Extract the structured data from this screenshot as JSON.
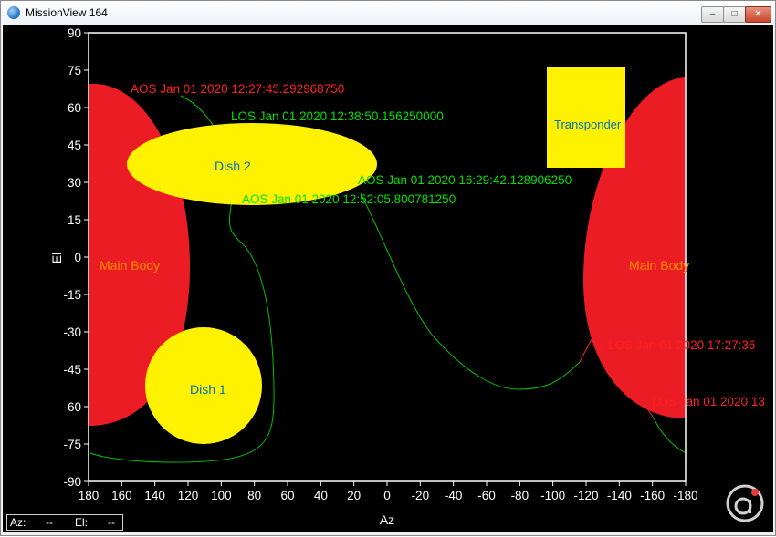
{
  "window": {
    "title": "MissionView 164",
    "min_label": "–",
    "max_label": "□",
    "close_label": "✕"
  },
  "colors": {
    "background": "#000000",
    "axis": "#ffffff",
    "body": "#ec1c24",
    "object": "#fff200",
    "track": "#00c000",
    "aos": "#00e000",
    "los_red": "#ff2020",
    "object_label": "#0070c0",
    "body_label": "#ff8c00"
  },
  "axes": {
    "x_label": "Az",
    "y_label": "El",
    "x_ticks": [
      "180",
      "160",
      "140",
      "120",
      "100",
      "80",
      "60",
      "40",
      "20",
      "0",
      "-20",
      "-40",
      "-60",
      "-80",
      "-100",
      "-120",
      "-140",
      "-160",
      "-180"
    ],
    "y_ticks": [
      "90",
      "75",
      "60",
      "45",
      "30",
      "15",
      "0",
      "-15",
      "-30",
      "-45",
      "-60",
      "-75",
      "-90"
    ]
  },
  "objects": {
    "body_left": "Main Body",
    "body_right": "Main Body",
    "dish1": "Dish 1",
    "dish2": "Dish 2",
    "transponder": "Transponder"
  },
  "events": {
    "aos1": "AOS Jan 01 2020 12:27:45.292968750",
    "los1": "LOS Jan 01 2020 12:38:50.156250000",
    "aos2": "AOS Jan 01 2020 16:29:42.128906250",
    "aos3": "AOS Jan 01 2020 12:52:05.800781250",
    "los2": "LOS Jan 01 2020 17:27:36",
    "los3": "LOS Jan 01 2020 13"
  },
  "status": {
    "az_label": "Az:",
    "az_value": "--",
    "el_label": "El:",
    "el_value": "--"
  },
  "logo": {
    "icon": "company-logo-icon"
  }
}
